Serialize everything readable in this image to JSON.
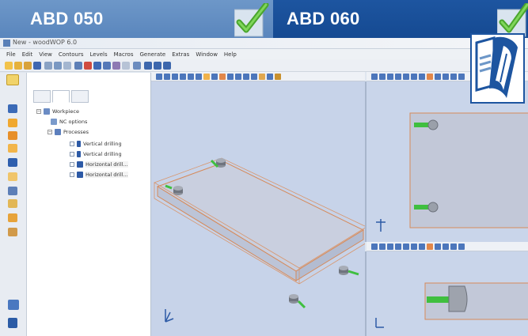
{
  "banner": {
    "left_label": "ABD 050",
    "right_label": "ABD 060",
    "left_color": "#5f8cc3",
    "right_color": "#1a509a",
    "check_icon_color": "#5bb33a"
  },
  "window": {
    "title": "New - woodWOP 6.0",
    "menu": [
      "File",
      "Edit",
      "View",
      "Contours",
      "Levels",
      "Macros",
      "Generate",
      "Extras",
      "Window",
      "Help"
    ]
  },
  "tree": {
    "root": "Workpiece",
    "items": [
      {
        "label": "NC options",
        "level": 1
      },
      {
        "label": "Processes",
        "level": 1
      },
      {
        "label": "Vertical drilling",
        "level": 2
      },
      {
        "label": "Vertical drilling",
        "level": 2
      },
      {
        "label": "Horizontal drill...",
        "level": 2
      },
      {
        "label": "Horizontal drill...",
        "level": 2
      }
    ]
  },
  "icons": {
    "manual": "manual-book-icon",
    "check": "checkmark-icon",
    "axis": "axis-gizmo-icon"
  },
  "colors": {
    "viewport_bg": "#c7d3e9",
    "workpiece_outline": "#d68a5a",
    "drill_green": "#3fbf3f"
  }
}
